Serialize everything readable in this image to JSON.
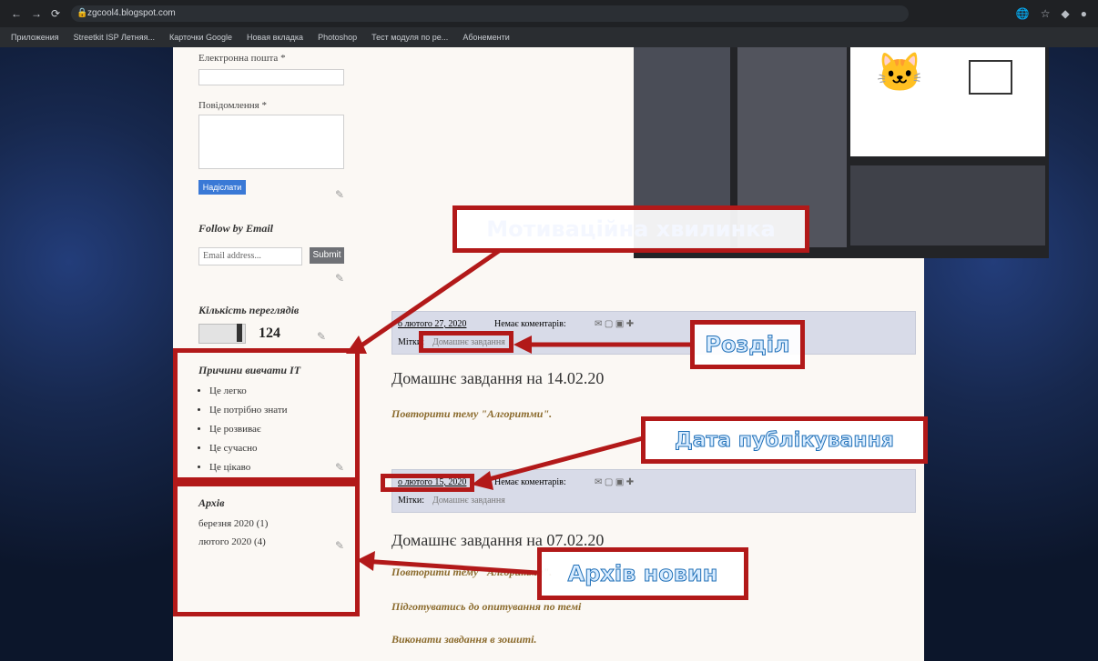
{
  "browser": {
    "url": "zgcool4.blogspot.com",
    "bookmarks": [
      "Приложения",
      "Streetkit ISP Летняя...",
      "Карточки Google",
      "Новая вкладка",
      "Photoshop",
      "Тест модуля по ре...",
      "Абонементи"
    ]
  },
  "sidebar": {
    "email_label": "Електронна пошта *",
    "message_label": "Повідомлення *",
    "submit_label": "Надіслати",
    "follow_heading": "Follow by Email",
    "email_placeholder": "Email address...",
    "follow_submit": "Submit",
    "views_heading": "Кількість переглядів",
    "views_count": "124",
    "reasons_heading": "Причини вивчати ІТ",
    "reasons": [
      "Це легко",
      "Це потрібно знати",
      "Це розвиває",
      "Це сучасно",
      "Це цікаво"
    ],
    "archive_heading": "Архів",
    "archive_items": [
      "березня 2020 (1)",
      "лютого 2020 (4)"
    ]
  },
  "posts": [
    {
      "date": "о лютого 27, 2020",
      "comments": "Немає коментарів:",
      "labels_prefix": "Мітки:",
      "label": "Домашнє завдання",
      "title": "Домашнє завдання на 14.02.20",
      "lines": [
        "Повторити тему \"Алгоритми\"."
      ]
    },
    {
      "date": "о лютого 15, 2020",
      "comments": "Немає коментарів:",
      "labels_prefix": "Мітки:",
      "label": "Домашнє завдання",
      "title": "Домашнє завдання на 07.02.20",
      "lines": [
        "Повторити тему \"Алгоритми\".",
        "Підготуватись до опитування по темі",
        "Виконати завдання в зошиті."
      ]
    }
  ],
  "annotations": {
    "motivation": "Мотиваційна хвилинка",
    "section": "Розділ",
    "publish_date": "Дата публікування",
    "news_archive": "Архів новин"
  },
  "colors": {
    "accent_red": "#b21919",
    "annotation_blue": "#1f6fb7",
    "post_text_brown": "#8b6b2d"
  }
}
